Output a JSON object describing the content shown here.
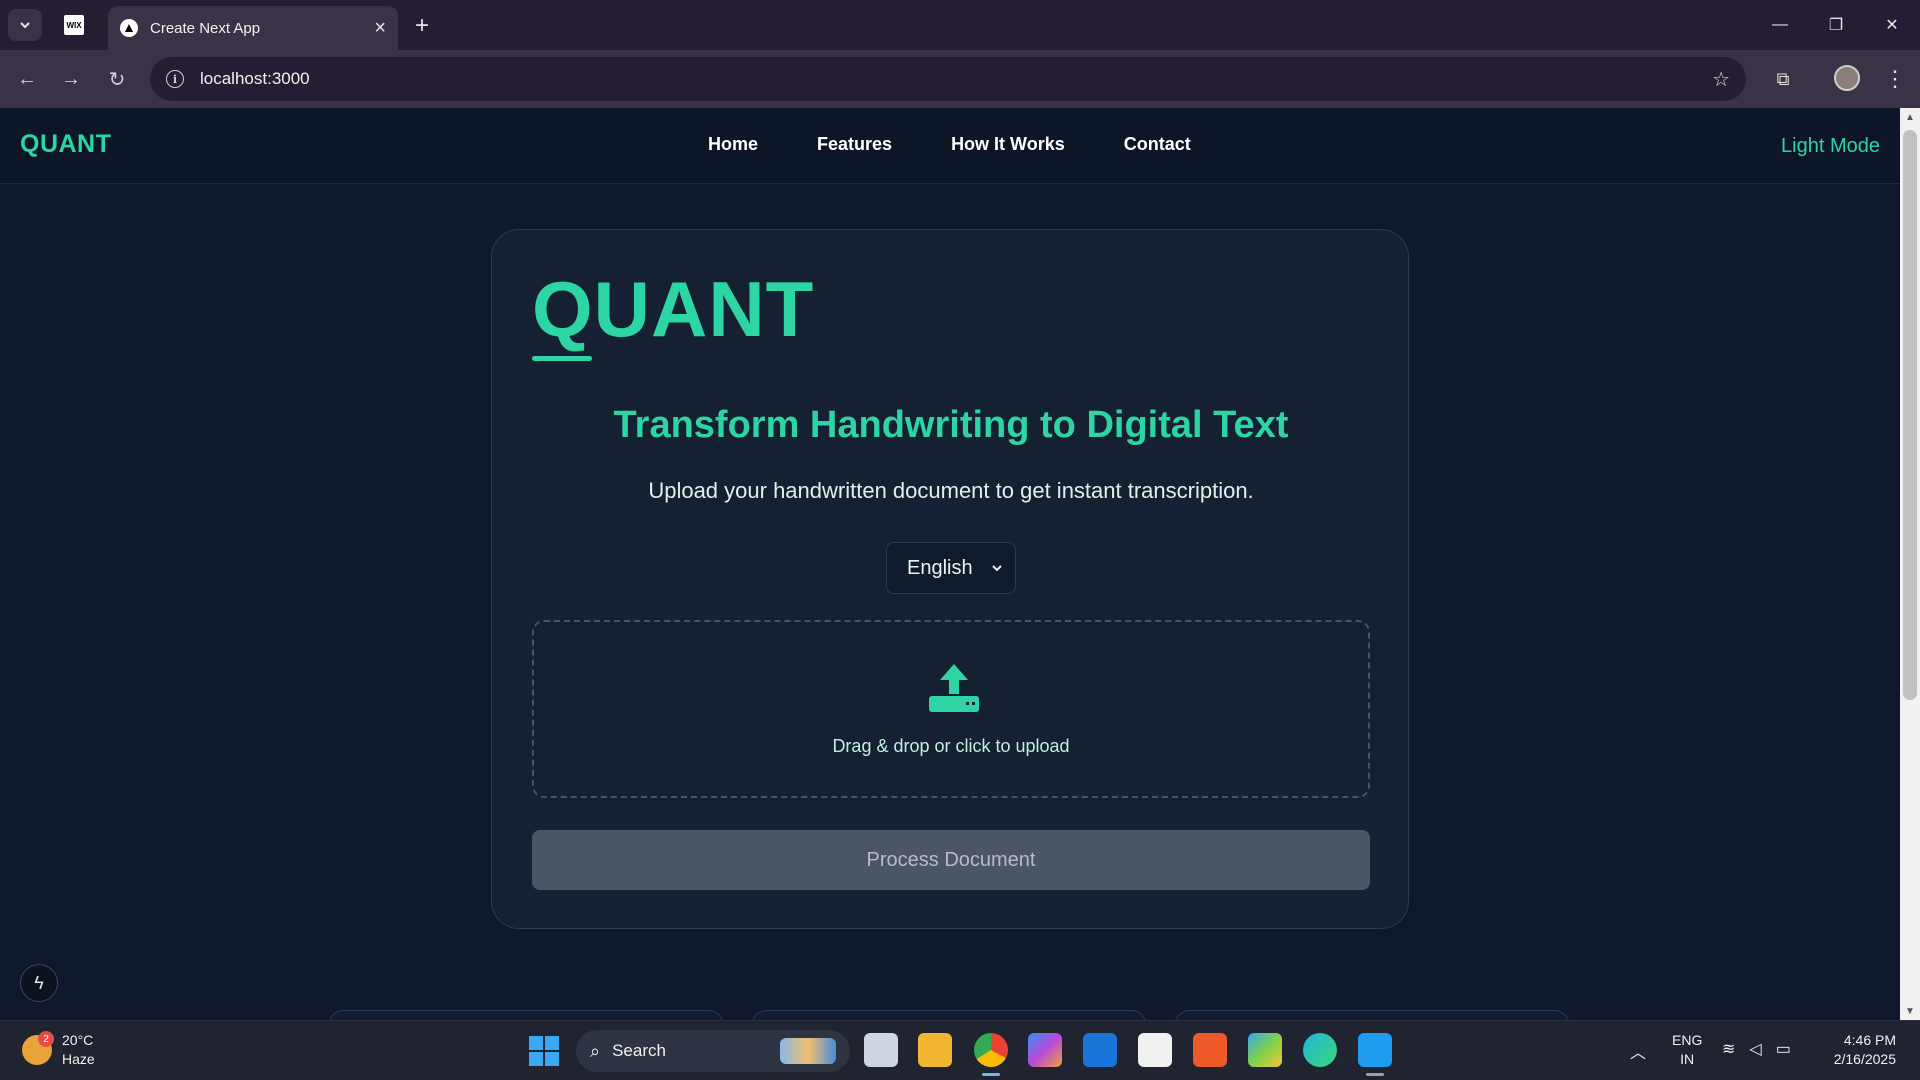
{
  "browser": {
    "pinned_tab_icon": "WIX",
    "active_tab_title": "Create Next App",
    "url": "localhost:3000"
  },
  "site": {
    "logo": "QUANT",
    "nav": [
      "Home",
      "Features",
      "How It Works",
      "Contact"
    ],
    "theme_toggle": "Light Mode",
    "accent_color": "#2dd4a4"
  },
  "card": {
    "brand": "QUANT",
    "heading": "Transform Handwriting to Digital Text",
    "subtext": "Upload your handwritten document to get instant transcription.",
    "language": "English",
    "dropzone_text": "Drag & drop or click to upload",
    "process_button": "Process Document"
  },
  "taskbar": {
    "weather_temp": "20°C",
    "weather_cond": "Haze",
    "weather_badge": "2",
    "search_label": "Search",
    "lang_line1": "ENG",
    "lang_line2": "IN",
    "time": "4:46 PM",
    "date": "2/16/2025"
  }
}
